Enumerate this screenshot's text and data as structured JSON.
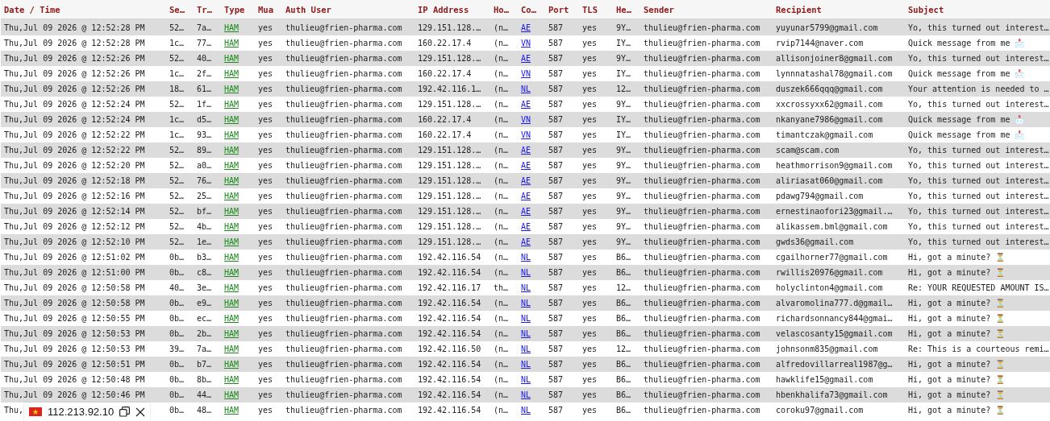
{
  "table": {
    "columns": [
      {
        "label": "Date / Time",
        "kind": "text"
      },
      {
        "label": "Se…",
        "kind": "text"
      },
      {
        "label": "Tr…",
        "kind": "text"
      },
      {
        "label": "Type",
        "kind": "type"
      },
      {
        "label": "Mua",
        "kind": "text"
      },
      {
        "label": "Auth User",
        "kind": "text"
      },
      {
        "label": "IP Address",
        "kind": "text"
      },
      {
        "label": "Ho…",
        "kind": "text"
      },
      {
        "label": "Co…",
        "kind": "country"
      },
      {
        "label": "Port",
        "kind": "text"
      },
      {
        "label": "TLS",
        "kind": "text"
      },
      {
        "label": "He…",
        "kind": "text"
      },
      {
        "label": "Sender",
        "kind": "text"
      },
      {
        "label": "Recipient",
        "kind": "text"
      },
      {
        "label": "Subject",
        "kind": "text"
      }
    ],
    "rows": [
      [
        "Thu,Jul 09 2026 @ 12:52:28 PM",
        "52…",
        "7a…",
        "HAM",
        "yes",
        "thulieu@frien-pharma.com",
        "129.151.128.…",
        "(n…",
        "AE",
        "587",
        "yes",
        "9Y…",
        "thulieu@frien-pharma.com",
        "yuyunar5799@gmail.com",
        "Yo, this turned out interest…"
      ],
      [
        "Thu,Jul 09 2026 @ 12:52:28 PM",
        "1c…",
        "77…",
        "HAM",
        "yes",
        "thulieu@frien-pharma.com",
        "160.22.17.4",
        "(n…",
        "VN",
        "587",
        "yes",
        "IY…",
        "thulieu@frien-pharma.com",
        "rvip7144@naver.com",
        "Quick message from me 📩"
      ],
      [
        "Thu,Jul 09 2026 @ 12:52:26 PM",
        "52…",
        "40…",
        "HAM",
        "yes",
        "thulieu@frien-pharma.com",
        "129.151.128.…",
        "(n…",
        "AE",
        "587",
        "yes",
        "9Y…",
        "thulieu@frien-pharma.com",
        "allisonjoiner8@gmail.com",
        "Yo, this turned out interest…"
      ],
      [
        "Thu,Jul 09 2026 @ 12:52:26 PM",
        "1c…",
        "2f…",
        "HAM",
        "yes",
        "thulieu@frien-pharma.com",
        "160.22.17.4",
        "(n…",
        "VN",
        "587",
        "yes",
        "IY…",
        "thulieu@frien-pharma.com",
        "lynnnatashal78@gmail.com",
        "Quick message from me 📩"
      ],
      [
        "Thu,Jul 09 2026 @ 12:52:26 PM",
        "18…",
        "61…",
        "HAM",
        "yes",
        "thulieu@frien-pharma.com",
        "192.42.116.1…",
        "(n…",
        "NL",
        "587",
        "yes",
        "12…",
        "thulieu@frien-pharma.com",
        "duszek666qqq@gmail.com",
        "Your attention is needed to …"
      ],
      [
        "Thu,Jul 09 2026 @ 12:52:24 PM",
        "52…",
        "1f…",
        "HAM",
        "yes",
        "thulieu@frien-pharma.com",
        "129.151.128.…",
        "(n…",
        "AE",
        "587",
        "yes",
        "9Y…",
        "thulieu@frien-pharma.com",
        "xxcrossyxx62@gmail.com",
        "Yo, this turned out interest…"
      ],
      [
        "Thu,Jul 09 2026 @ 12:52:24 PM",
        "1c…",
        "d5…",
        "HAM",
        "yes",
        "thulieu@frien-pharma.com",
        "160.22.17.4",
        "(n…",
        "VN",
        "587",
        "yes",
        "IY…",
        "thulieu@frien-pharma.com",
        "nkanyane7986@gmail.com",
        "Quick message from me 📩"
      ],
      [
        "Thu,Jul 09 2026 @ 12:52:22 PM",
        "1c…",
        "93…",
        "HAM",
        "yes",
        "thulieu@frien-pharma.com",
        "160.22.17.4",
        "(n…",
        "VN",
        "587",
        "yes",
        "IY…",
        "thulieu@frien-pharma.com",
        "timantczak@gmail.com",
        "Quick message from me 📩"
      ],
      [
        "Thu,Jul 09 2026 @ 12:52:22 PM",
        "52…",
        "89…",
        "HAM",
        "yes",
        "thulieu@frien-pharma.com",
        "129.151.128.…",
        "(n…",
        "AE",
        "587",
        "yes",
        "9Y…",
        "thulieu@frien-pharma.com",
        "scam@scam.com",
        "Yo, this turned out interest…"
      ],
      [
        "Thu,Jul 09 2026 @ 12:52:20 PM",
        "52…",
        "a0…",
        "HAM",
        "yes",
        "thulieu@frien-pharma.com",
        "129.151.128.…",
        "(n…",
        "AE",
        "587",
        "yes",
        "9Y…",
        "thulieu@frien-pharma.com",
        "heathmorrison9@gmail.com",
        "Yo, this turned out interest…"
      ],
      [
        "Thu,Jul 09 2026 @ 12:52:18 PM",
        "52…",
        "76…",
        "HAM",
        "yes",
        "thulieu@frien-pharma.com",
        "129.151.128.…",
        "(n…",
        "AE",
        "587",
        "yes",
        "9Y…",
        "thulieu@frien-pharma.com",
        "aliriasat060@gmail.com",
        "Yo, this turned out interest…"
      ],
      [
        "Thu,Jul 09 2026 @ 12:52:16 PM",
        "52…",
        "25…",
        "HAM",
        "yes",
        "thulieu@frien-pharma.com",
        "129.151.128.…",
        "(n…",
        "AE",
        "587",
        "yes",
        "9Y…",
        "thulieu@frien-pharma.com",
        "pdawg794@gmail.com",
        "Yo, this turned out interest…"
      ],
      [
        "Thu,Jul 09 2026 @ 12:52:14 PM",
        "52…",
        "bf…",
        "HAM",
        "yes",
        "thulieu@frien-pharma.com",
        "129.151.128.…",
        "(n…",
        "AE",
        "587",
        "yes",
        "9Y…",
        "thulieu@frien-pharma.com",
        "ernestinaofori23@gmail.…",
        "Yo, this turned out interest…"
      ],
      [
        "Thu,Jul 09 2026 @ 12:52:12 PM",
        "52…",
        "4b…",
        "HAM",
        "yes",
        "thulieu@frien-pharma.com",
        "129.151.128.…",
        "(n…",
        "AE",
        "587",
        "yes",
        "9Y…",
        "thulieu@frien-pharma.com",
        "alikassem.bml@gmail.com",
        "Yo, this turned out interest…"
      ],
      [
        "Thu,Jul 09 2026 @ 12:52:10 PM",
        "52…",
        "1e…",
        "HAM",
        "yes",
        "thulieu@frien-pharma.com",
        "129.151.128.…",
        "(n…",
        "AE",
        "587",
        "yes",
        "9Y…",
        "thulieu@frien-pharma.com",
        "gwds36@gmail.com",
        "Yo, this turned out interest…"
      ],
      [
        "Thu,Jul 09 2026 @ 12:51:02 PM",
        "0b…",
        "b3…",
        "HAM",
        "yes",
        "thulieu@frien-pharma.com",
        "192.42.116.54",
        "(n…",
        "NL",
        "587",
        "yes",
        "B6…",
        "thulieu@frien-pharma.com",
        "cgailhorner77@gmail.com",
        "Hi, got a minute? ⏳"
      ],
      [
        "Thu,Jul 09 2026 @ 12:51:00 PM",
        "0b…",
        "c8…",
        "HAM",
        "yes",
        "thulieu@frien-pharma.com",
        "192.42.116.54",
        "(n…",
        "NL",
        "587",
        "yes",
        "B6…",
        "thulieu@frien-pharma.com",
        "rwillis20976@gmail.com",
        "Hi, got a minute? ⏳"
      ],
      [
        "Thu,Jul 09 2026 @ 12:50:58 PM",
        "40…",
        "3e…",
        "HAM",
        "yes",
        "thulieu@frien-pharma.com",
        "192.42.116.17",
        "th…",
        "NL",
        "587",
        "yes",
        "12…",
        "thulieu@frien-pharma.com",
        "holyclinton4@gmail.com",
        "Re: YOUR REQUESTED AMOUNT IS…"
      ],
      [
        "Thu,Jul 09 2026 @ 12:50:58 PM",
        "0b…",
        "e9…",
        "HAM",
        "yes",
        "thulieu@frien-pharma.com",
        "192.42.116.54",
        "(n…",
        "NL",
        "587",
        "yes",
        "B6…",
        "thulieu@frien-pharma.com",
        "alvaromolina777.d@gmail…",
        "Hi, got a minute? ⏳"
      ],
      [
        "Thu,Jul 09 2026 @ 12:50:55 PM",
        "0b…",
        "ec…",
        "HAM",
        "yes",
        "thulieu@frien-pharma.com",
        "192.42.116.54",
        "(n…",
        "NL",
        "587",
        "yes",
        "B6…",
        "thulieu@frien-pharma.com",
        "richardsonnancy844@gmai…",
        "Hi, got a minute? ⏳"
      ],
      [
        "Thu,Jul 09 2026 @ 12:50:53 PM",
        "0b…",
        "2b…",
        "HAM",
        "yes",
        "thulieu@frien-pharma.com",
        "192.42.116.54",
        "(n…",
        "NL",
        "587",
        "yes",
        "B6…",
        "thulieu@frien-pharma.com",
        "velascosanty15@gmail.com",
        "Hi, got a minute? ⏳"
      ],
      [
        "Thu,Jul 09 2026 @ 12:50:53 PM",
        "39…",
        "7a…",
        "HAM",
        "yes",
        "thulieu@frien-pharma.com",
        "192.42.116.50",
        "(n…",
        "NL",
        "587",
        "yes",
        "12…",
        "thulieu@frien-pharma.com",
        "johnsonm835@gmail.com",
        "Re: This is a courteous remi…"
      ],
      [
        "Thu,Jul 09 2026 @ 12:50:51 PM",
        "0b…",
        "b7…",
        "HAM",
        "yes",
        "thulieu@frien-pharma.com",
        "192.42.116.54",
        "(n…",
        "NL",
        "587",
        "yes",
        "B6…",
        "thulieu@frien-pharma.com",
        "alfredovillarreal1987@g…",
        "Hi, got a minute? ⏳"
      ],
      [
        "Thu,Jul 09 2026 @ 12:50:48 PM",
        "0b…",
        "8b…",
        "HAM",
        "yes",
        "thulieu@frien-pharma.com",
        "192.42.116.54",
        "(n…",
        "NL",
        "587",
        "yes",
        "B6…",
        "thulieu@frien-pharma.com",
        "hawklife15@gmail.com",
        "Hi, got a minute? ⏳"
      ],
      [
        "Thu,Jul 09 2026 @ 12:50:46 PM",
        "0b…",
        "44…",
        "HAM",
        "yes",
        "thulieu@frien-pharma.com",
        "192.42.116.54",
        "(n…",
        "NL",
        "587",
        "yes",
        "B6…",
        "thulieu@frien-pharma.com",
        "hbenkhalifa73@gmail.com",
        "Hi, got a minute? ⏳"
      ],
      [
        "Thu,",
        "0b…",
        "48…",
        "HAM",
        "yes",
        "thulieu@frien-pharma.com",
        "192.42.116.54",
        "(n…",
        "NL",
        "587",
        "yes",
        "B6…",
        "thulieu@frien-pharma.com",
        "coroku97@gmail.com",
        "Hi, got a minute? ⏳"
      ]
    ]
  },
  "ip_popup": {
    "ip": "112.213.92.10"
  }
}
